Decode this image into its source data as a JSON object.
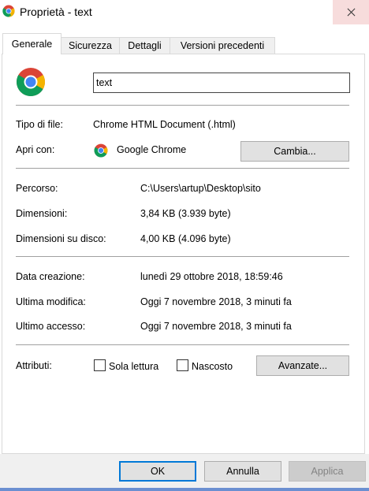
{
  "window": {
    "title": "Proprietà - text",
    "icon": "chrome-icon",
    "close_icon": "close-icon"
  },
  "tabs": [
    {
      "label": "Generale",
      "active": true
    },
    {
      "label": "Sicurezza",
      "active": false
    },
    {
      "label": "Dettagli",
      "active": false
    },
    {
      "label": "Versioni precedenti",
      "active": false
    }
  ],
  "general": {
    "file_name": "text",
    "file_type_label": "Tipo di file:",
    "file_type_value": "Chrome HTML Document (.html)",
    "open_with_label": "Apri con:",
    "open_with_value": "Google Chrome",
    "change_button": "Cambia...",
    "location_label": "Percorso:",
    "location_value": "C:\\Users\\artup\\Desktop\\sito",
    "size_label": "Dimensioni:",
    "size_value": "3,84 KB (3.939 byte)",
    "size_on_disk_label": "Dimensioni su disco:",
    "size_on_disk_value": "4,00 KB (4.096 byte)",
    "created_label": "Data creazione:",
    "created_value": "lunedì 29 ottobre 2018, 18:59:46",
    "modified_label": "Ultima modifica:",
    "modified_value": "Oggi 7 novembre 2018, 3 minuti fa",
    "accessed_label": "Ultimo accesso:",
    "accessed_value": "Oggi 7 novembre 2018, 3 minuti fa",
    "attributes_label": "Attributi:",
    "readonly_label": "Sola lettura",
    "readonly_checked": false,
    "hidden_label": "Nascosto",
    "hidden_checked": false,
    "advanced_button": "Avanzate..."
  },
  "footer": {
    "ok": "OK",
    "cancel": "Annulla",
    "apply": "Applica"
  },
  "colors": {
    "accent": "#0078d7",
    "close_hover": "#f7dcdc",
    "button_face": "#e1e1e1",
    "footer_bg": "#f0f0f0"
  }
}
